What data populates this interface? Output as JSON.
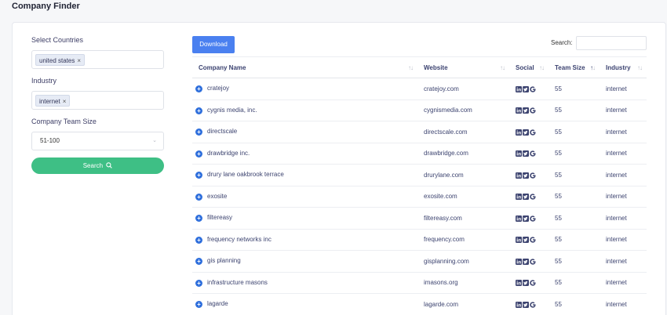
{
  "page": {
    "title": "Company Finder"
  },
  "filters": {
    "countries_label": "Select Countries",
    "countries_chip": "united states",
    "industry_label": "Industry",
    "industry_chip": "internet",
    "team_size_label": "Company Team Size",
    "team_size_value": "51-100",
    "search_button": "Search",
    "chip_remove": "×"
  },
  "toolbar": {
    "download_label": "Download",
    "search_label": "Search:",
    "search_value": ""
  },
  "table": {
    "headers": {
      "name": "Company Name",
      "website": "Website",
      "social": "Social",
      "team_size": "Team Size",
      "industry": "Industry"
    },
    "rows": [
      {
        "name": "cratejoy",
        "website": "cratejoy.com",
        "team_size": "55",
        "industry": "internet"
      },
      {
        "name": "cygnis media, inc.",
        "website": "cygnismedia.com",
        "team_size": "55",
        "industry": "internet"
      },
      {
        "name": "directscale",
        "website": "directscale.com",
        "team_size": "55",
        "industry": "internet"
      },
      {
        "name": "drawbridge inc.",
        "website": "drawbridge.com",
        "team_size": "55",
        "industry": "internet"
      },
      {
        "name": "drury lane oakbrook terrace",
        "website": "drurylane.com",
        "team_size": "55",
        "industry": "internet"
      },
      {
        "name": "exosite",
        "website": "exosite.com",
        "team_size": "55",
        "industry": "internet"
      },
      {
        "name": "filtereasy",
        "website": "filtereasy.com",
        "team_size": "55",
        "industry": "internet"
      },
      {
        "name": "frequency networks inc",
        "website": "frequency.com",
        "team_size": "55",
        "industry": "internet"
      },
      {
        "name": "gis planning",
        "website": "gisplanning.com",
        "team_size": "55",
        "industry": "internet"
      },
      {
        "name": "infrastructure masons",
        "website": "imasons.org",
        "team_size": "55",
        "industry": "internet"
      },
      {
        "name": "lagarde",
        "website": "lagarde.com",
        "team_size": "55",
        "industry": "internet"
      }
    ]
  },
  "icons": {
    "expand": "plus-circle-icon",
    "linkedin": "linkedin-icon",
    "twitter": "twitter-icon",
    "google": "google-icon",
    "search": "search-icon"
  },
  "colors": {
    "primary": "#4a80f0",
    "success": "#3ebf85",
    "expand": "#2f6fdc"
  }
}
